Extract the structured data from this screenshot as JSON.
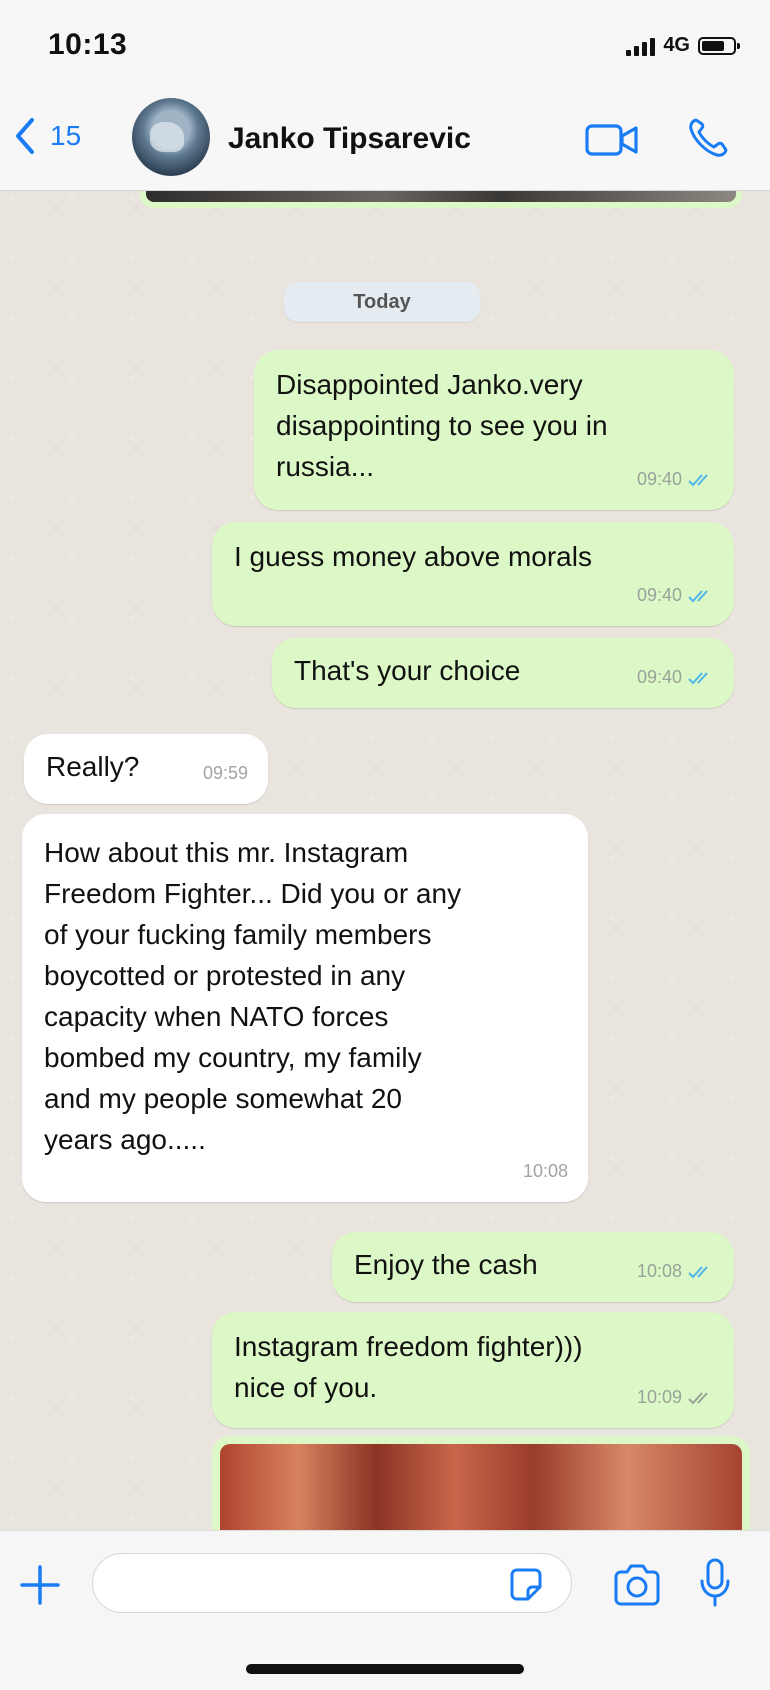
{
  "status_bar": {
    "time": "10:13",
    "network": "4G"
  },
  "header": {
    "back_count": "15",
    "contact_name": "Janko Tipsarevic",
    "icons": [
      "chevron-left-icon",
      "video-call-icon",
      "phone-icon"
    ]
  },
  "chat": {
    "date_label": "Today",
    "messages": [
      {
        "direction": "outgoing",
        "text_lines": [
          "Disappointed Janko.very",
          "disappointing to see you in",
          "russia..."
        ],
        "time": "09:40",
        "status": "read"
      },
      {
        "direction": "outgoing",
        "text": "I guess money above morals",
        "time": "09:40",
        "status": "read"
      },
      {
        "direction": "outgoing",
        "text": "That's your choice",
        "time": "09:40",
        "status": "read"
      },
      {
        "direction": "incoming",
        "text": "Really?",
        "time": "09:59"
      },
      {
        "direction": "incoming",
        "text_lines": [
          "How about this mr. Instagram",
          "Freedom Fighter... Did you or any",
          "of your fucking family members",
          "boycotted or protested in any",
          "capacity when NATO forces",
          "bombed my country, my family",
          "and my people somewhat 20",
          "years ago....."
        ],
        "time": "10:08"
      },
      {
        "direction": "outgoing",
        "text": "Enjoy the cash",
        "time": "10:08",
        "status": "read"
      },
      {
        "direction": "outgoing",
        "text_lines": [
          "Instagram freedom fighter)))",
          "nice of you."
        ],
        "time": "10:09",
        "status": "delivered"
      }
    ]
  },
  "input_bar": {
    "placeholder": "",
    "icons": [
      "plus-icon",
      "sticker-icon",
      "camera-icon",
      "mic-icon"
    ]
  },
  "colors": {
    "outgoing_bubble": "#dcf8c6",
    "incoming_bubble": "#ffffff",
    "accent_blue": "#1a7cf5",
    "read_tick": "#4fb6ec",
    "delivered_tick": "#9aa39a"
  }
}
